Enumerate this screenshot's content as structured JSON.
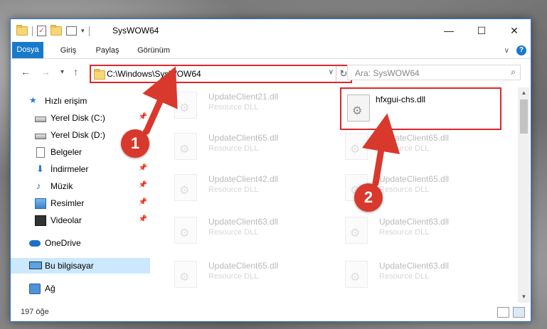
{
  "window": {
    "title": "SysWOW64",
    "minimize": "—",
    "maximize": "☐",
    "close": "✕"
  },
  "ribbon": {
    "tabs": [
      "Dosya",
      "Giriş",
      "Paylaş",
      "Görünüm"
    ],
    "collapse_icon": "chevron-down-icon",
    "help_label": "?"
  },
  "nav": {
    "back": "←",
    "forward": "→",
    "recent": "▾",
    "up": "↑",
    "address": "C:\\Windows\\SysWOW64",
    "address_dropdown": "∨",
    "refresh": "↻",
    "search_placeholder": "Ara: SysWOW64",
    "search_icon": "⌕"
  },
  "sidebar": {
    "items": [
      {
        "label": "Hızlı erişim",
        "icon": "star-icon"
      },
      {
        "label": "Yerel Disk (C:)",
        "icon": "drive-icon",
        "pinned": true
      },
      {
        "label": "Yerel Disk (D:)",
        "icon": "drive-icon",
        "pinned": true
      },
      {
        "label": "Belgeler",
        "icon": "documents-icon",
        "pinned": true
      },
      {
        "label": "İndirmeler",
        "icon": "downloads-icon",
        "pinned": true
      },
      {
        "label": "Müzik",
        "icon": "music-icon",
        "pinned": true
      },
      {
        "label": "Resimler",
        "icon": "pictures-icon",
        "pinned": true
      },
      {
        "label": "Videolar",
        "icon": "videos-icon",
        "pinned": true
      },
      {
        "label": "OneDrive",
        "icon": "cloud-icon"
      },
      {
        "label": "Bu bilgisayar",
        "icon": "computer-icon",
        "selected": true
      },
      {
        "label": "Ağ",
        "icon": "network-icon"
      }
    ],
    "pin_glyph": "📌"
  },
  "files": [
    {
      "name": "UpdateClient21.dll",
      "type": "Resource DLL"
    },
    {
      "name": "hfxgui-chs.dll",
      "type": "",
      "highlighted": true
    },
    {
      "name": "UpdateClient65.dll",
      "type": "Resource DLL"
    },
    {
      "name": "UpdateClient65.dll",
      "type": "Resource DLL"
    },
    {
      "name": "UpdateClient42.dll",
      "type": "Resource DLL"
    },
    {
      "name": "UpdateClient65.dll",
      "type": "Resource DLL"
    },
    {
      "name": "UpdateClient63.dll",
      "type": "Resource DLL"
    },
    {
      "name": "UpdateClient63.dll",
      "type": "Resource DLL"
    },
    {
      "name": "UpdateClient65.dll",
      "type": "Resource DLL"
    },
    {
      "name": "UpdateClient63.dll",
      "type": "Resource DLL"
    }
  ],
  "status": {
    "count": "197 öğe"
  },
  "annotations": {
    "marker1": "1",
    "marker2": "2",
    "color": "#d9392c"
  }
}
